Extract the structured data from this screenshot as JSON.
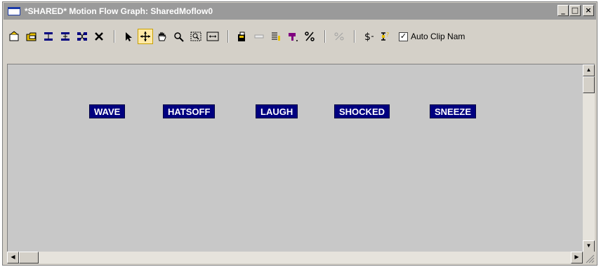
{
  "window": {
    "title": "*SHARED* Motion Flow Graph: SharedMoflow0",
    "minimize": "_",
    "maximize": "□",
    "close": "×"
  },
  "toolbar": {
    "auto_clip_label": "Auto Clip Nam",
    "auto_clip_checked": "✓"
  },
  "nodes": [
    {
      "label": "WAVE"
    },
    {
      "label": "HATSOFF"
    },
    {
      "label": "LAUGH"
    },
    {
      "label": "SHOCKED"
    },
    {
      "label": "SNEEZE"
    }
  ],
  "scrollbar": {
    "up": "▲",
    "down": "▼",
    "left": "◀",
    "right": "▶"
  },
  "colors": {
    "title_bar": "#9a9a9a",
    "node_bg": "#000080",
    "canvas_bg": "#c8c8c8"
  }
}
